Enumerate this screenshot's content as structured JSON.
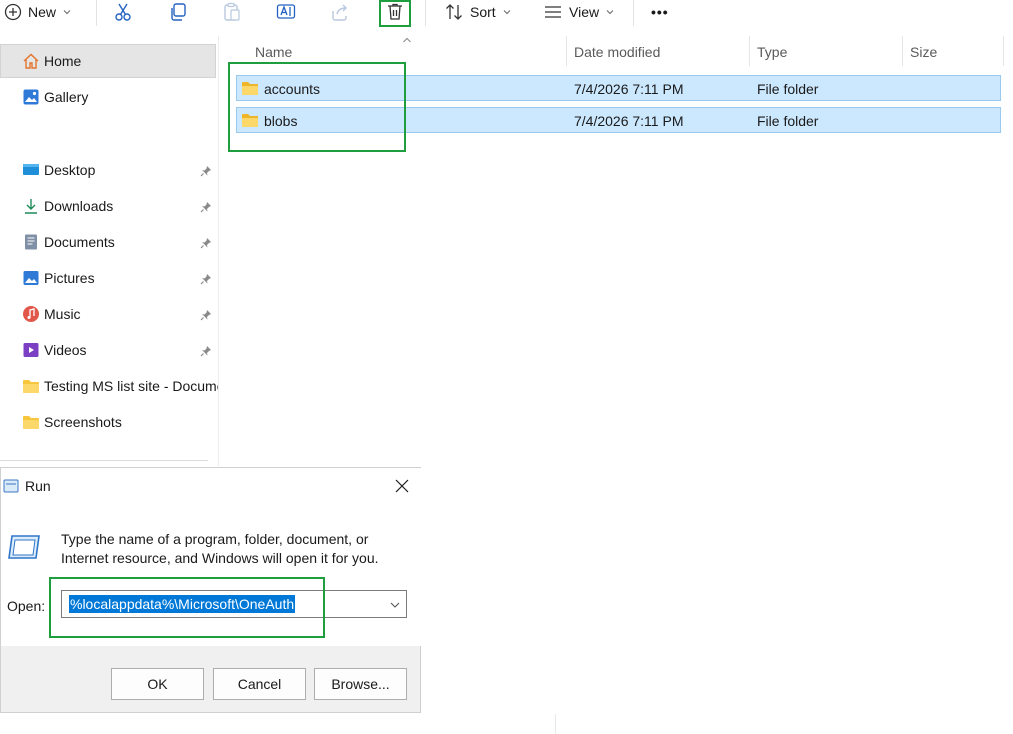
{
  "toolbar": {
    "new_label": "New",
    "sort_label": "Sort",
    "view_label": "View",
    "more_label": "•••"
  },
  "nav": {
    "items": [
      {
        "label": "Home",
        "icon": "home-icon"
      },
      {
        "label": "Gallery",
        "icon": "gallery-icon"
      },
      {
        "label": "Desktop",
        "icon": "desktop-icon",
        "pinned": true
      },
      {
        "label": "Downloads",
        "icon": "downloads-icon",
        "pinned": true
      },
      {
        "label": "Documents",
        "icon": "documents-icon",
        "pinned": true
      },
      {
        "label": "Pictures",
        "icon": "pictures-icon",
        "pinned": true
      },
      {
        "label": "Music",
        "icon": "music-icon",
        "pinned": true
      },
      {
        "label": "Videos",
        "icon": "videos-icon",
        "pinned": true
      },
      {
        "label": "Testing MS list site - Documents",
        "icon": "folder-icon"
      },
      {
        "label": "Screenshots",
        "icon": "folder-icon"
      }
    ]
  },
  "filelist": {
    "columns": {
      "name": "Name",
      "date": "Date modified",
      "type": "Type",
      "size": "Size"
    },
    "rows": [
      {
        "name": "accounts",
        "date": "7/4/2026 7:11 PM",
        "type": "File folder",
        "size": ""
      },
      {
        "name": "blobs",
        "date": "7/4/2026 7:11 PM",
        "type": "File folder",
        "size": ""
      }
    ]
  },
  "run": {
    "title": "Run",
    "description_line1": "Type the name of a program, folder, document, or",
    "description_line2": "Internet resource, and Windows will open it for you.",
    "open_label": "Open:",
    "open_value": "%localappdata%\\Microsoft\\OneAuth",
    "ok_label": "OK",
    "cancel_label": "Cancel",
    "browse_label": "Browse..."
  },
  "colors": {
    "highlight_box": "#1e9e3e",
    "selection": "#cce8ff",
    "folder": "#f8c63d",
    "accent": "#0078d7"
  }
}
